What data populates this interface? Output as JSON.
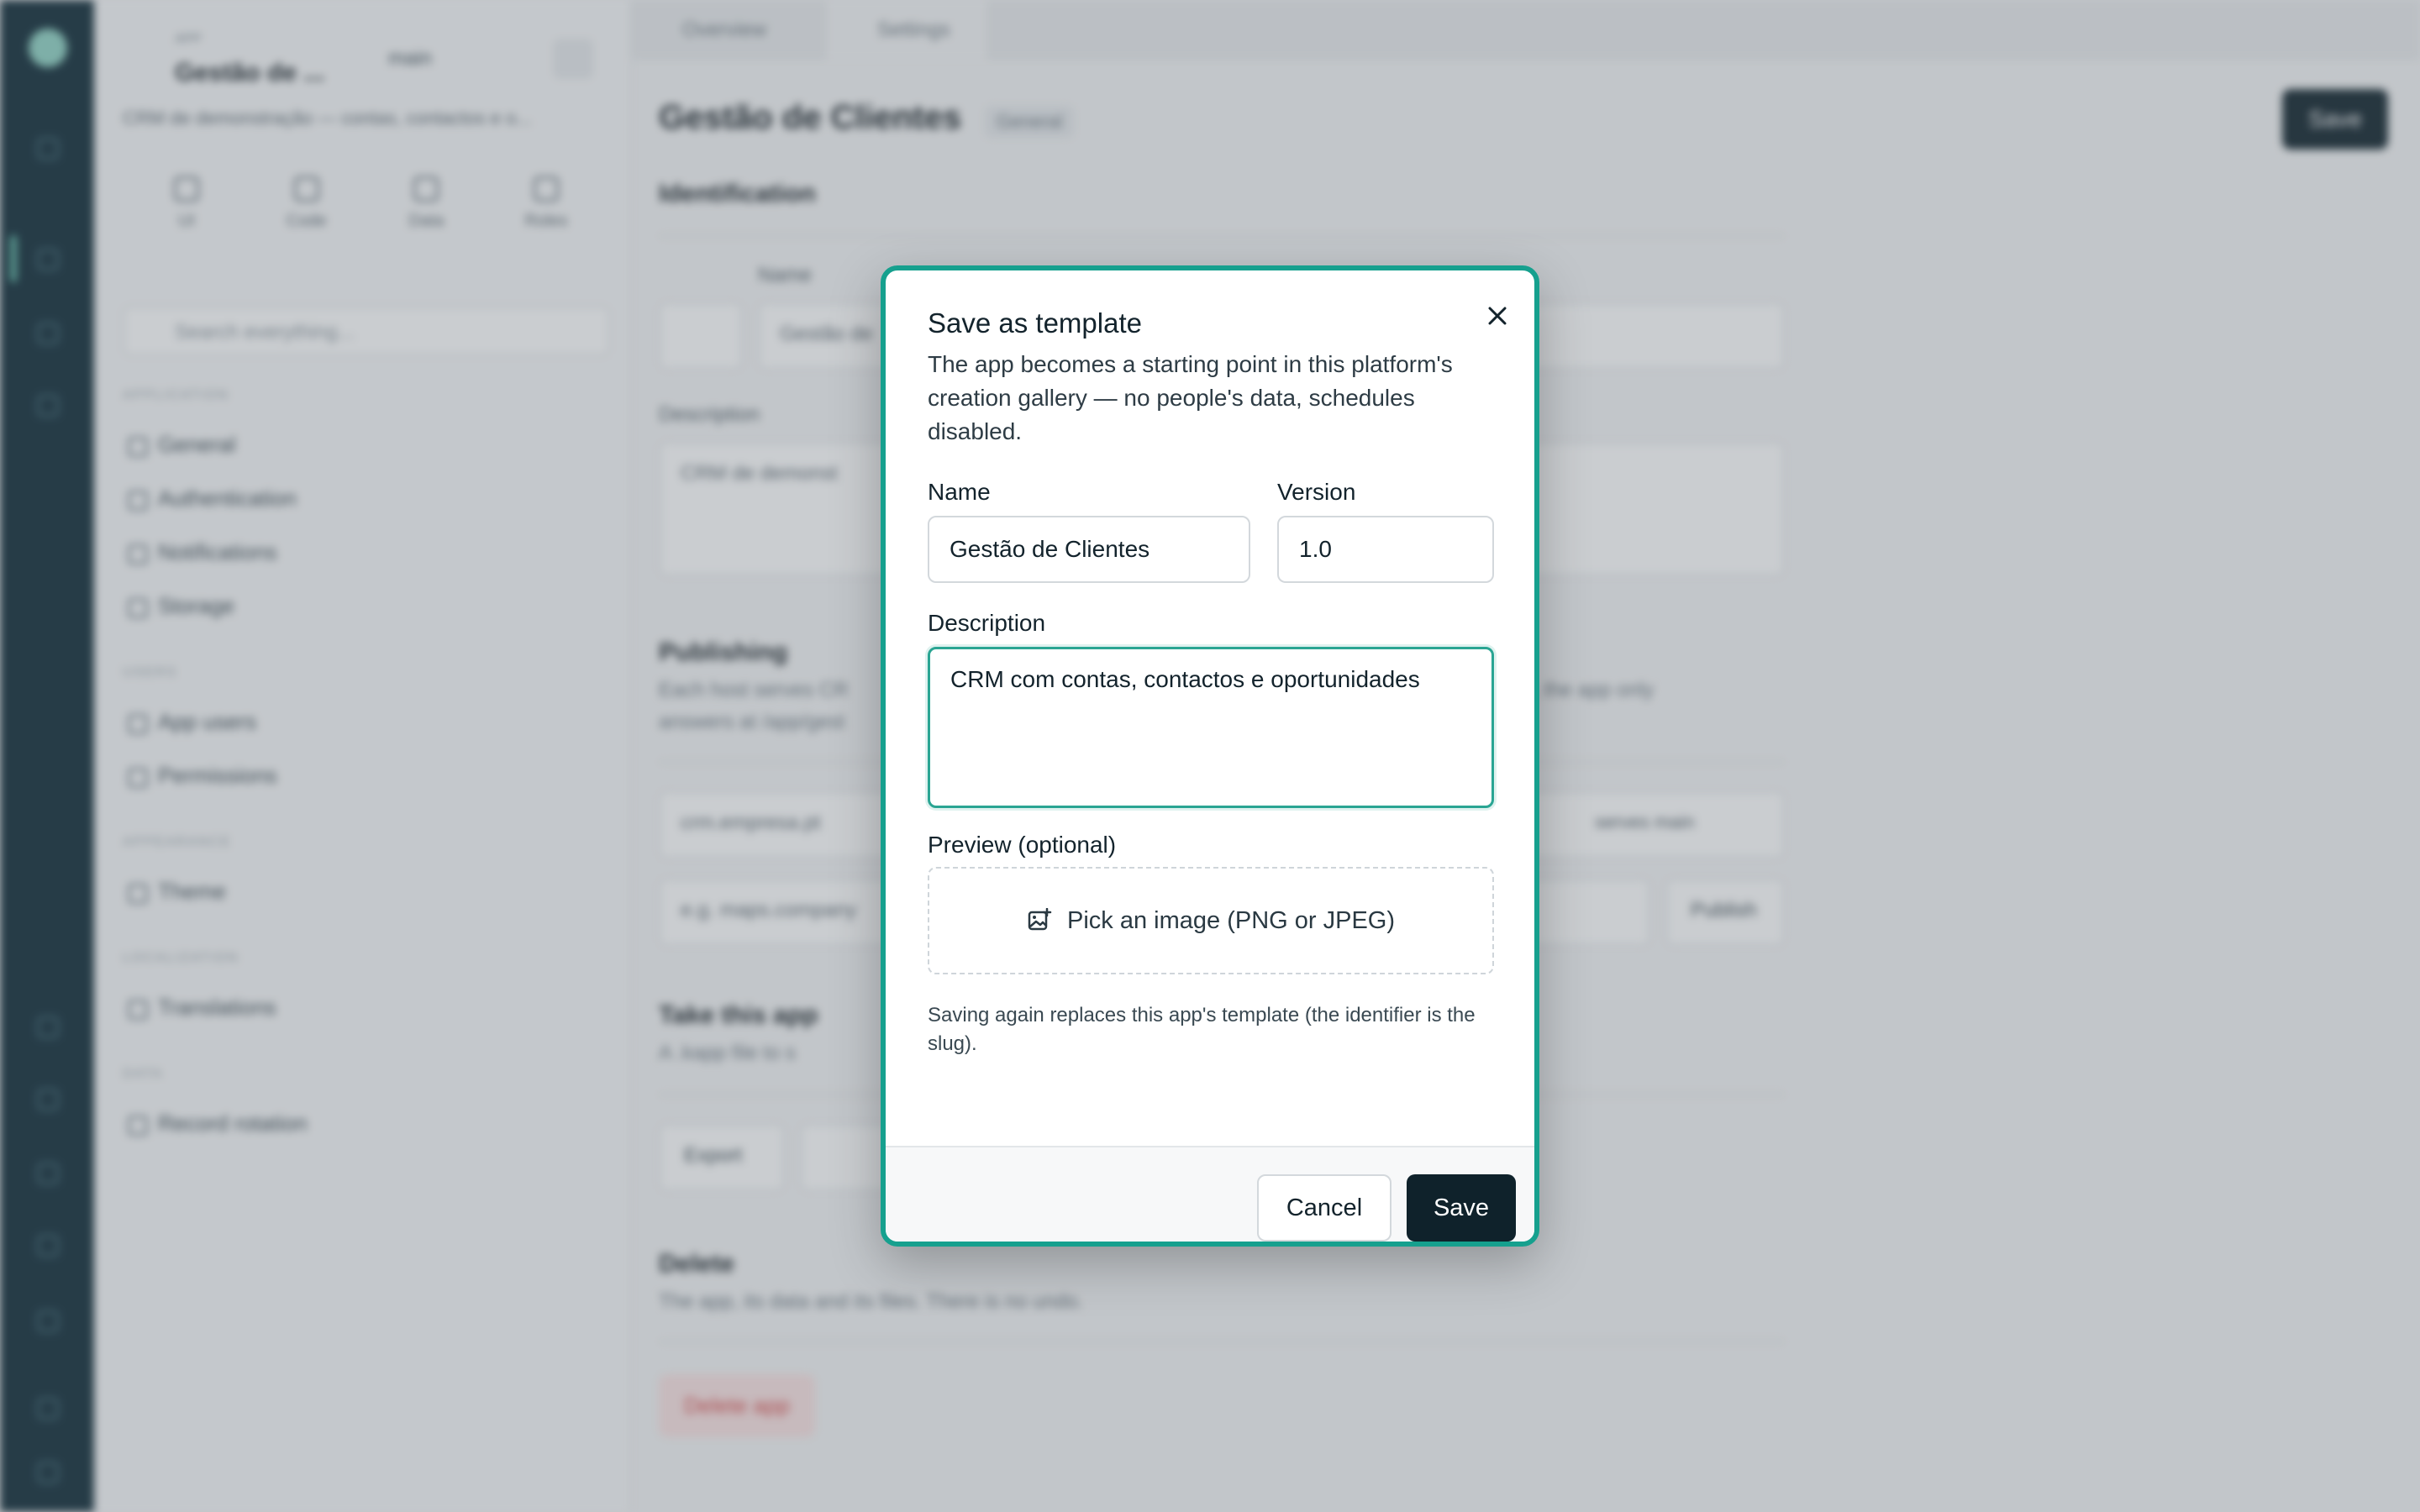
{
  "background": {
    "sidebar": {
      "app_small_label": "APP",
      "app_name": "Gestão de ...",
      "app_description": "CRM de demonstração — contas, contactos e o...",
      "branch": "main",
      "tools": [
        "UI",
        "Code",
        "Data",
        "Roles"
      ],
      "search_placeholder": "Search everything...",
      "sections": [
        {
          "title": "APPLICATION",
          "items": [
            "General",
            "Authentication",
            "Notifications",
            "Storage"
          ]
        },
        {
          "title": "USERS",
          "items": [
            "App users",
            "Permissions"
          ]
        },
        {
          "title": "APPEARANCE",
          "items": [
            "Theme"
          ]
        },
        {
          "title": "LOCALIZATION",
          "items": [
            "Translations"
          ]
        },
        {
          "title": "DATA",
          "items": [
            "Record rotation"
          ]
        }
      ]
    },
    "tabs": [
      "Overview",
      "Settings"
    ],
    "main": {
      "title": "Gestão de Clientes",
      "badge": "General",
      "save_label": "Save",
      "identification_heading": "Identification",
      "name_label": "Name",
      "name_value": "Gestão de",
      "description_label": "Description",
      "description_value": "CRM de demonst",
      "publishing_heading": "Publishing",
      "publishing_text_1": "Each host serves CR",
      "publishing_text_1b": "s, the app only",
      "publishing_text_2": "answers at /app/gest",
      "domain_value": "crm.empresa.pt",
      "domain_badge": "serves main",
      "domain_placeholder": "e.g. maps.company",
      "publish_button": "Publish",
      "take_heading": "Take this app",
      "take_text": "A .kapp file to s",
      "export_button": "Export",
      "delete_heading": "Delete",
      "delete_text": "The app, its data and its files. There is no undo.",
      "delete_button": "Delete app"
    }
  },
  "modal": {
    "title": "Save as template",
    "subtitle": "The app becomes a starting point in this platform's creation gallery — no people's data, schedules disabled.",
    "name_label": "Name",
    "name_value": "Gestão de Clientes",
    "version_label": "Version",
    "version_value": "1.0",
    "description_label": "Description",
    "description_value": "CRM com contas, contactos e oportunidades",
    "preview_label": "Preview (optional)",
    "preview_button": "Pick an image (PNG or JPEG)",
    "hint": "Saving again replaces this app's template (the identifier is the slug).",
    "cancel_label": "Cancel",
    "save_label": "Save"
  },
  "colors": {
    "accent": "#16a08e",
    "primary_button": "#0f222b",
    "rail": "#0e2a36"
  }
}
